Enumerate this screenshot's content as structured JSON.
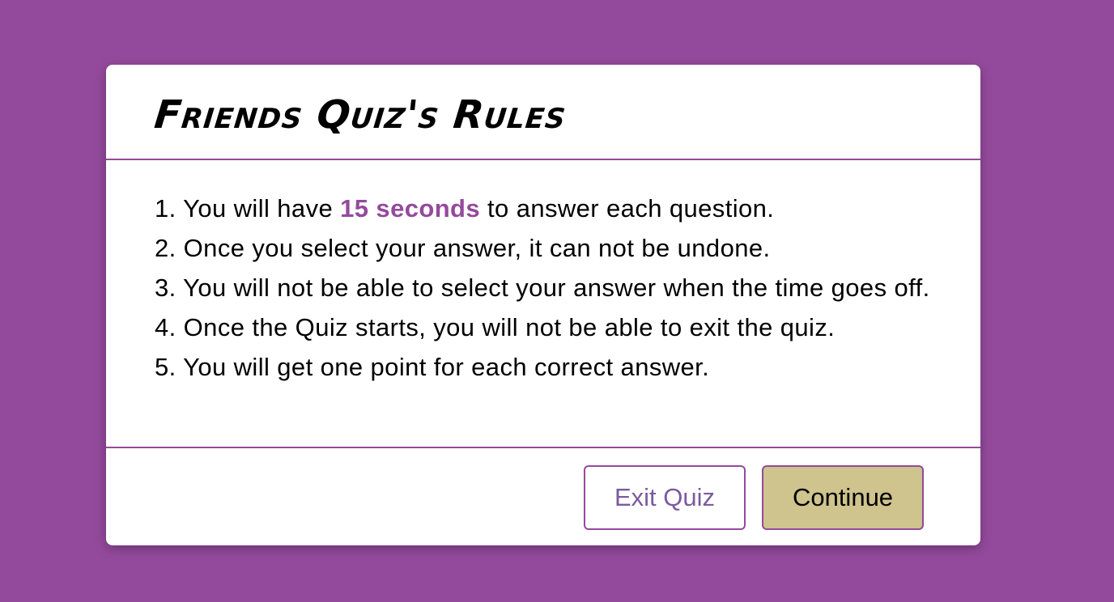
{
  "modal": {
    "title": "Friends Quiz's Rules",
    "rules": [
      {
        "number": "1.",
        "before": "You will have",
        "highlight": "15 seconds",
        "after": "to answer each question."
      },
      {
        "number": "2.",
        "text": "Once you select your answer, it can not be undone."
      },
      {
        "number": "3.",
        "text": "You will not be able to select your answer when the time goes off."
      },
      {
        "number": "4.",
        "text": "Once the Quiz starts, you will not be able to exit the quiz."
      },
      {
        "number": "5.",
        "text": "You will get one point for each correct answer."
      }
    ],
    "buttons": {
      "exit_label": "Exit Quiz",
      "continue_label": "Continue"
    }
  },
  "colors": {
    "background": "#944a9c",
    "accent": "#944a9c",
    "continue_button": "#cfc38e",
    "exit_button_text": "#7b5b9e"
  }
}
